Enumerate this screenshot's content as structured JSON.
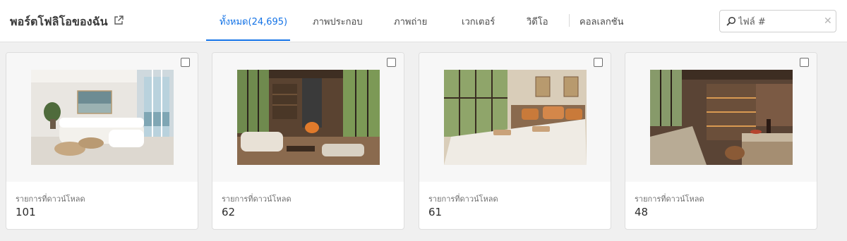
{
  "header": {
    "portfolio_title": "พอร์ตโฟลิโอของฉัน",
    "external_link_icon": "external-link-icon"
  },
  "tabs": [
    {
      "label": "ทั้งหมด(24,695)",
      "active": true
    },
    {
      "label": "ภาพประกอบ",
      "active": false
    },
    {
      "label": "ภาพถ่าย",
      "active": false
    },
    {
      "label": "เวกเตอร์",
      "active": false
    },
    {
      "label": "วิดีโอ",
      "active": false
    },
    {
      "label": "คอลเลกชัน",
      "active": false
    }
  ],
  "search": {
    "placeholder": "ไฟล์ #",
    "value": "",
    "icon": "search-icon",
    "clear_icon": "close-icon"
  },
  "cards": [
    {
      "label": "รายการที่ดาวน์โหลด",
      "value": "101",
      "checked": false,
      "thumbnail": "bright living room with white sofa and ocean view"
    },
    {
      "label": "รายการที่ดาวน์โหลด",
      "value": "62",
      "checked": false,
      "thumbnail": "wooden living room with fireplace and forest windows"
    },
    {
      "label": "รายการที่ดาวน์โหลด",
      "value": "61",
      "checked": false,
      "thumbnail": "bedroom with white bed and orange pillows near forest windows"
    },
    {
      "label": "รายการที่ดาวน์โหลด",
      "value": "48",
      "checked": false,
      "thumbnail": "wine cellar kitchen with wooden shelves and counter"
    }
  ],
  "colors": {
    "accent": "#1473e6",
    "background": "#f0f0f0",
    "card_background": "#ffffff"
  }
}
